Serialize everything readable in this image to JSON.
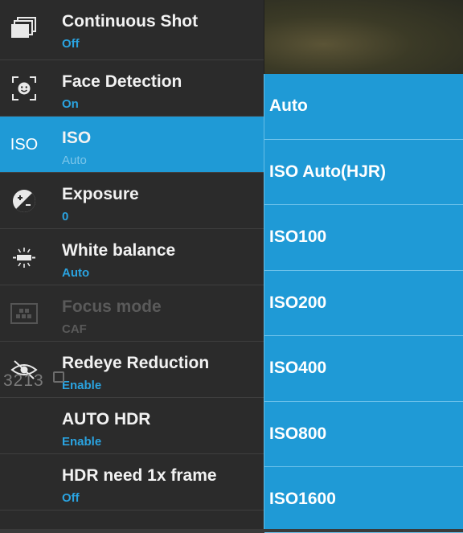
{
  "settings": {
    "items": [
      {
        "title": "Continuous Shot",
        "value": "Off",
        "icon": "stacked-frames-icon"
      },
      {
        "title": "Face Detection",
        "value": "On",
        "icon": "face-detection-icon"
      },
      {
        "title": "ISO",
        "value": "Auto",
        "icon": "iso-icon",
        "icon_text": "ISO"
      },
      {
        "title": "Exposure",
        "value": "0",
        "icon": "exposure-icon"
      },
      {
        "title": "White balance",
        "value": "Auto",
        "icon": "white-balance-icon"
      },
      {
        "title": "Focus mode",
        "value": "CAF",
        "icon": "focus-mode-icon"
      },
      {
        "title": "Redeye Reduction",
        "value": "Enable",
        "icon": "redeye-icon"
      },
      {
        "title": "AUTO HDR",
        "value": "Enable",
        "icon": ""
      },
      {
        "title": "HDR need 1x frame",
        "value": "Off",
        "icon": ""
      }
    ]
  },
  "overlay": {
    "shot_counter": "3213"
  },
  "iso_popup": {
    "options": [
      "Auto",
      "ISO Auto(HJR)",
      "ISO100",
      "ISO200",
      "ISO400",
      "ISO800",
      "ISO1600"
    ]
  },
  "colors": {
    "accent": "#1f9ad6",
    "list_background": "#2b2b2b",
    "value_text": "#2aa3e0"
  }
}
